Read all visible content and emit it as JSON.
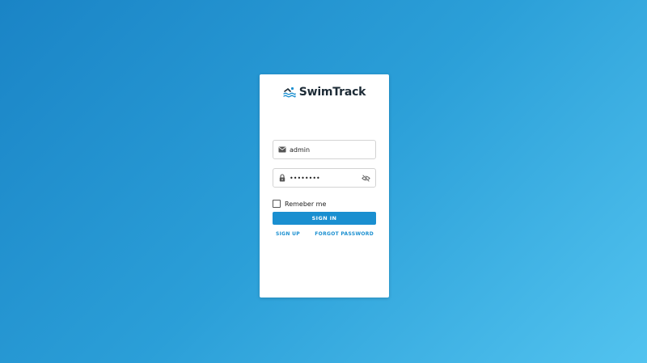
{
  "brand": {
    "name": "SwimTrack",
    "icon": "swimmer-icon",
    "accent_color": "#1a8fd0",
    "text_color": "#1d2b36"
  },
  "login": {
    "email_value": "admin",
    "email_icon": "email-icon",
    "password_value": "••••••••",
    "password_icon": "lock-icon",
    "visibility_icon": "eye-off-icon",
    "remember_label": "Remeber me",
    "remember_checked": false,
    "signin_label": "SIGN IN",
    "signup_label": "SIGN UP",
    "forgot_label": "FORGOT PASSWORD"
  },
  "background": {
    "gradient_start": "#1a84c6",
    "gradient_end": "#52c3ef"
  }
}
